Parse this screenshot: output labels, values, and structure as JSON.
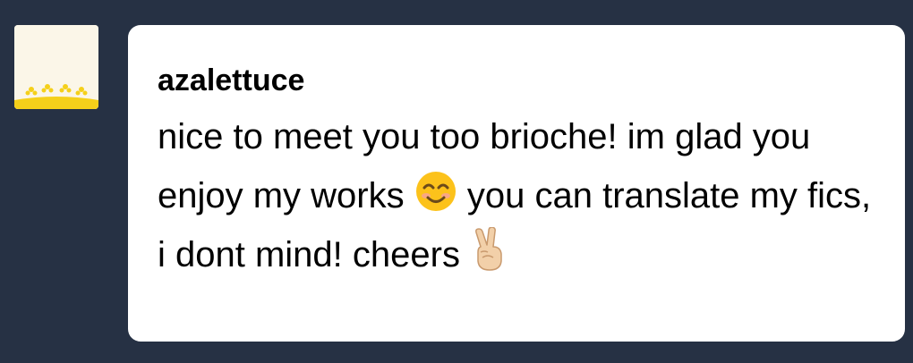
{
  "user": {
    "name": "azalettuce"
  },
  "message": {
    "text_before_smile": "nice to meet you too brioche! im glad you enjoy my works ",
    "text_after_smile": " you can translate my fics, i dont mind! cheers ",
    "emojis": [
      "smiling-face-icon",
      "victory-hand-icon"
    ]
  },
  "colors": {
    "background": "#263144",
    "bubble": "#ffffff",
    "avatar_bg": "#fbf6e8",
    "avatar_accent": "#f5d01a",
    "text": "#000000"
  }
}
